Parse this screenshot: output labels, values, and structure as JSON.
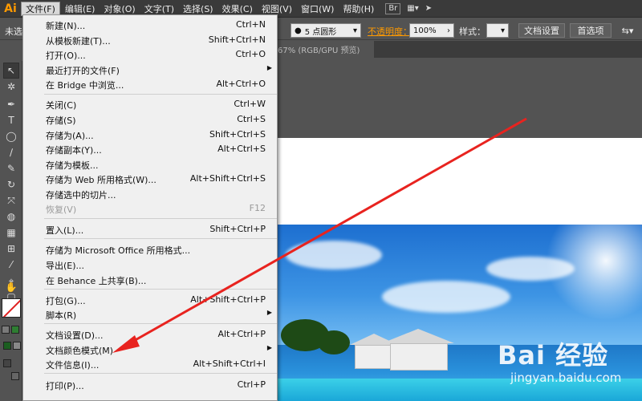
{
  "app": {
    "logo": "Ai"
  },
  "menubar": {
    "items": [
      "文件(F)",
      "编辑(E)",
      "对象(O)",
      "文字(T)",
      "选择(S)",
      "效果(C)",
      "视图(V)",
      "窗口(W)",
      "帮助(H)"
    ],
    "bridge_label": "Br"
  },
  "controlbar": {
    "unselected_label": "未选",
    "brush_value": "5 点圆形",
    "opacity_label": "不透明度：",
    "opacity_value": "100%",
    "style_label": "样式：",
    "doc_settings_label": "文档设置",
    "preferences_label": "首选项"
  },
  "doc_tab": {
    "label": "67% (RGB/GPU 预览)"
  },
  "file_menu": {
    "items": [
      {
        "label": "新建(N)...",
        "shortcut": "Ctrl+N"
      },
      {
        "label": "从模板新建(T)...",
        "shortcut": "Shift+Ctrl+N"
      },
      {
        "label": "打开(O)...",
        "shortcut": "Ctrl+O"
      },
      {
        "label": "最近打开的文件(F)",
        "shortcut": ""
      },
      {
        "label": "在 Bridge 中浏览...",
        "shortcut": "Alt+Ctrl+O"
      },
      {
        "label": "关闭(C)",
        "shortcut": "Ctrl+W"
      },
      {
        "label": "存储(S)",
        "shortcut": "Ctrl+S"
      },
      {
        "label": "存储为(A)...",
        "shortcut": "Shift+Ctrl+S"
      },
      {
        "label": "存储副本(Y)...",
        "shortcut": "Alt+Ctrl+S"
      },
      {
        "label": "存储为模板...",
        "shortcut": ""
      },
      {
        "label": "存储为 Web 所用格式(W)...",
        "shortcut": "Alt+Shift+Ctrl+S"
      },
      {
        "label": "存储选中的切片...",
        "shortcut": ""
      },
      {
        "label": "恢复(V)",
        "shortcut": "F12"
      },
      {
        "label": "置入(L)...",
        "shortcut": "Shift+Ctrl+P"
      },
      {
        "label": "存储为 Microsoft Office 所用格式...",
        "shortcut": ""
      },
      {
        "label": "导出(E)...",
        "shortcut": ""
      },
      {
        "label": "在 Behance 上共享(B)...",
        "shortcut": ""
      },
      {
        "label": "打包(G)...",
        "shortcut": "Alt+Shift+Ctrl+P"
      },
      {
        "label": "脚本(R)",
        "shortcut": ""
      },
      {
        "label": "文档设置(D)...",
        "shortcut": "Alt+Ctrl+P"
      },
      {
        "label": "文档颜色模式(M)",
        "shortcut": ""
      },
      {
        "label": "文件信息(I)...",
        "shortcut": "Alt+Shift+Ctrl+I"
      },
      {
        "label": "打印(P)...",
        "shortcut": "Ctrl+P"
      }
    ]
  },
  "watermark": {
    "brand": "Bai 经验",
    "site": "jingyan.baidu.com"
  },
  "colors": {
    "annotation_arrow": "#e8231f",
    "logo": "#ff9a00",
    "opacity_label": "#ff9a00"
  }
}
